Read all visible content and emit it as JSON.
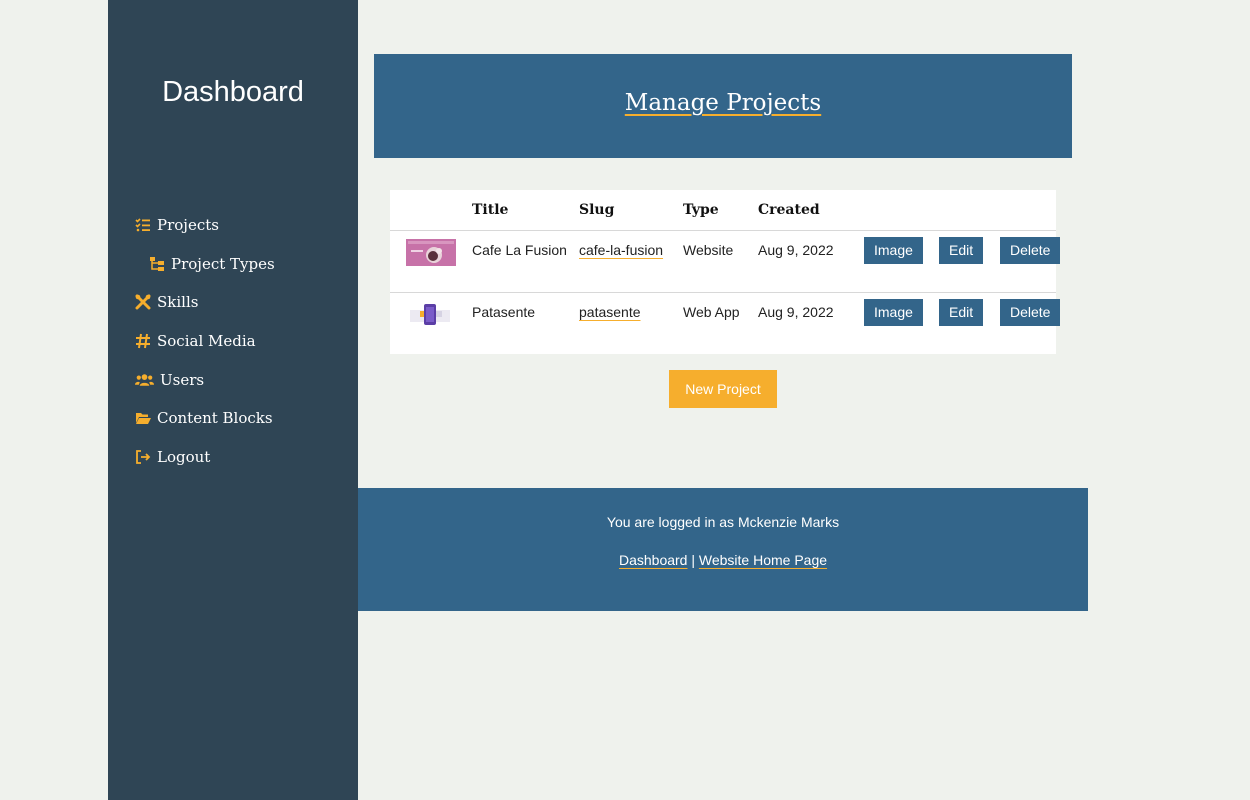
{
  "sidebar": {
    "title": "Dashboard",
    "items": [
      {
        "label": "Projects",
        "icon": "list-check-icon"
      },
      {
        "label": "Project Types",
        "icon": "sitemap-icon"
      },
      {
        "label": "Skills",
        "icon": "tools-icon"
      },
      {
        "label": "Social Media",
        "icon": "hashtag-icon"
      },
      {
        "label": "Users",
        "icon": "users-icon"
      },
      {
        "label": "Content Blocks",
        "icon": "folder-open-icon"
      },
      {
        "label": "Logout",
        "icon": "logout-icon"
      }
    ]
  },
  "header": {
    "title": "Manage Projects"
  },
  "table": {
    "columns": [
      "",
      "Title",
      "Slug",
      "Type",
      "Created",
      ""
    ],
    "rows": [
      {
        "title": "Cafe La Fusion",
        "slug": "cafe-la-fusion",
        "type": "Website",
        "created": "Aug 9, 2022",
        "thumb": "pink-website-thumbnail"
      },
      {
        "title": "Patasente",
        "slug": "patasente",
        "type": "Web App",
        "created": "Aug 9, 2022",
        "thumb": "purple-app-thumbnail"
      }
    ],
    "actions": {
      "image": "Image",
      "edit": "Edit",
      "delete": "Delete"
    }
  },
  "new_project_label": "New Project",
  "footer": {
    "login_text": "You are logged in as Mckenzie Marks",
    "link_dashboard": "Dashboard",
    "separator": "|",
    "link_home": "Website Home Page"
  },
  "colors": {
    "sidebar_bg": "#2f4555",
    "primary": "#33658a",
    "accent": "#f6ae2d",
    "page_bg": "#eff2ed"
  }
}
